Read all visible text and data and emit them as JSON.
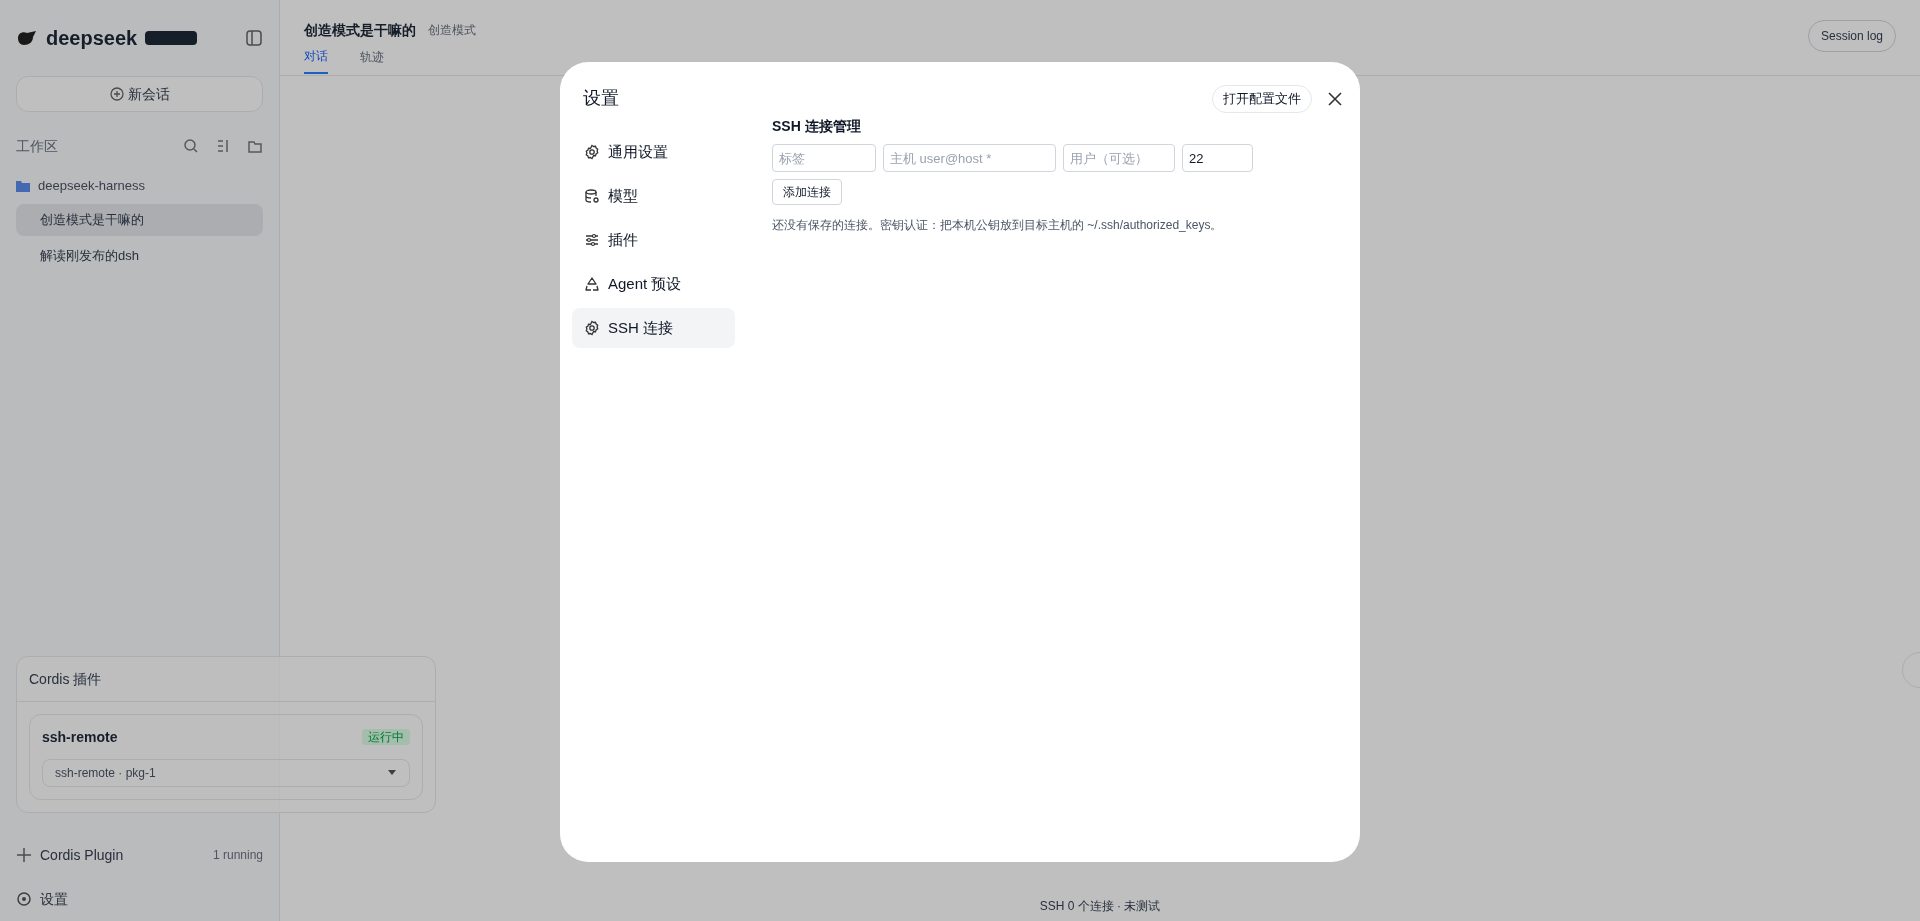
{
  "sidebar": {
    "logo": "deepseek",
    "new_chat": "新会话",
    "workspace_label": "工作区",
    "project": "deepseek-harness",
    "sessions": [
      {
        "title": "创造模式是干嘛的",
        "selected": true
      },
      {
        "title": "解读刚发布的dsh",
        "selected": false
      }
    ],
    "cordis_panel": {
      "title": "Cordis 插件",
      "plugin": "ssh-remote",
      "status": "运行中",
      "package": "ssh-remote · pkg-1"
    },
    "plugin_footer": {
      "label": "Cordis Plugin",
      "count": "1 running"
    },
    "settings": "设置"
  },
  "header": {
    "title": "创造模式是干嘛的",
    "mode": "创造模式",
    "tabs": [
      {
        "label": "对话",
        "selected": true
      },
      {
        "label": "轨迹",
        "selected": false
      }
    ],
    "session_log": "Session log"
  },
  "status_bar": "SSH 0 个连接 · 未测试",
  "dialog": {
    "title": "设置",
    "open_config": "打开配置文件",
    "nav": [
      {
        "label": "通用设置",
        "kind": "gear",
        "selected": false
      },
      {
        "label": "模型",
        "kind": "database",
        "selected": false
      },
      {
        "label": "插件",
        "kind": "sliders",
        "selected": false
      },
      {
        "label": "Agent 预设",
        "kind": "agent",
        "selected": false
      },
      {
        "label": "SSH 连接",
        "kind": "gear",
        "selected": true
      }
    ],
    "section_title": "SSH 连接管理",
    "fields": [
      {
        "placeholder": "标签"
      },
      {
        "placeholder": "主机 user@host *"
      },
      {
        "placeholder": "用户（可选）"
      },
      {
        "value": "22"
      }
    ],
    "add_button": "添加连接",
    "hint": "还没有保存的连接。密钥认证：把本机公钥放到目标主机的 ~/.ssh/authorized_keys。"
  }
}
